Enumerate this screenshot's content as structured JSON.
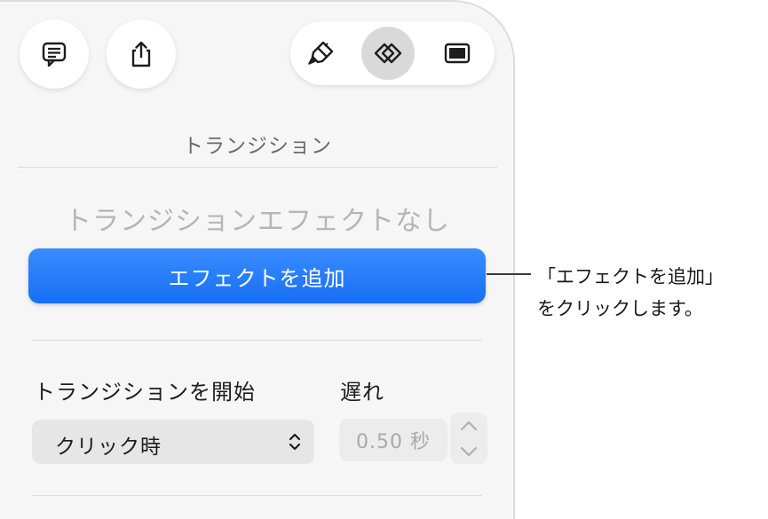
{
  "panel": {
    "section_title": "トランジション",
    "empty_state": "トランジションエフェクトなし",
    "add_effect_button": "エフェクトを追加",
    "start_transition_label": "トランジションを開始",
    "delay_label": "遅れ",
    "start_select_value": "クリック時",
    "delay_value": "0.50 秒"
  },
  "callout": {
    "line1": "「エフェクトを追加」",
    "line2": "をクリックします。"
  },
  "icons": {
    "comment": "comment-icon",
    "share": "share-icon",
    "format_brush": "paintbrush-icon",
    "animate": "animate-diamonds-icon",
    "document": "document-slide-icon"
  },
  "colors": {
    "accent_blue": "#1670f5",
    "panel_bg": "#f6f6f6",
    "active_tool_bg": "#d9d9d9"
  }
}
